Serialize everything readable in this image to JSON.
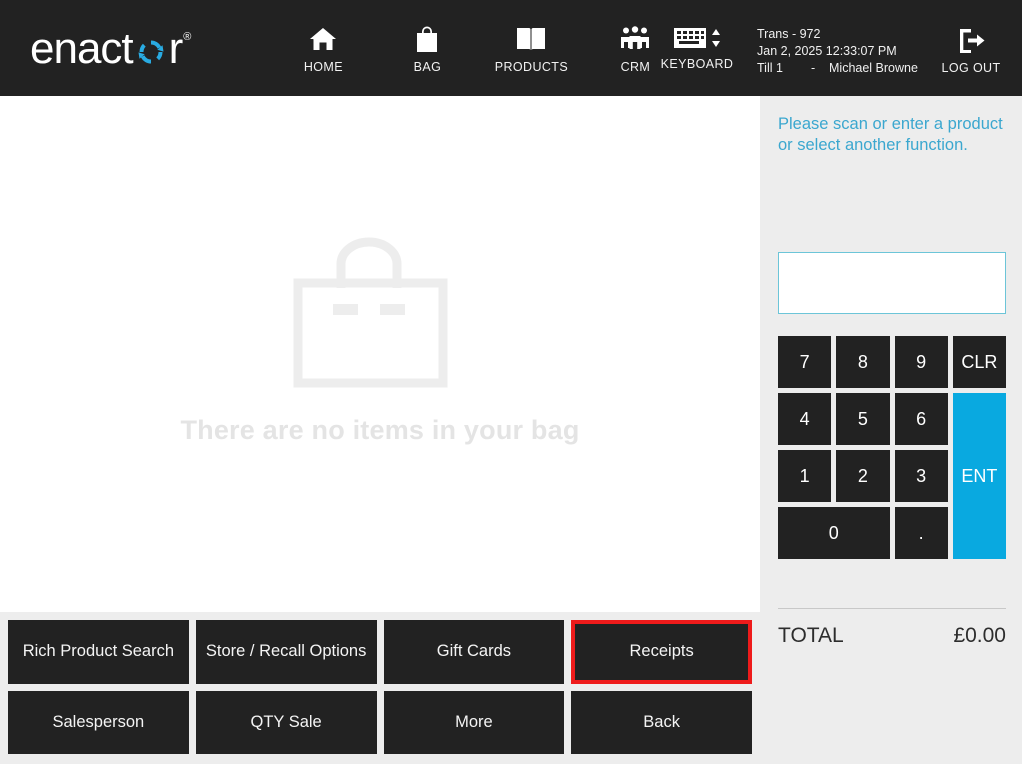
{
  "brand": {
    "name": "enactor",
    "name_part1": "enact",
    "name_part2": "r",
    "trademark": "®",
    "logo_icon": "circular-arrows-icon",
    "accent_color": "#29abe2"
  },
  "header": {
    "nav": [
      {
        "label": "HOME",
        "icon": "home-icon"
      },
      {
        "label": "BAG",
        "icon": "shopping-bag-icon"
      },
      {
        "label": "PRODUCTS",
        "icon": "open-book-icon"
      },
      {
        "label": "CRM",
        "icon": "people-group-icon"
      }
    ],
    "keyboard": {
      "label": "KEYBOARD",
      "icon": "keyboard-icon"
    },
    "transaction": {
      "trans": "Trans - 972",
      "datetime": "Jan 2, 2025 12:33:07 PM",
      "till": "Till 1",
      "separator": "-",
      "operator": "Michael Browne"
    },
    "logout": {
      "label": "LOG OUT",
      "icon": "logout-icon"
    }
  },
  "main": {
    "bag_icon": "empty-shopping-bag-illustration",
    "empty_message": "There are no items in your bag"
  },
  "function_buttons": [
    {
      "label": "Rich Product Search",
      "selected": false
    },
    {
      "label": "Store / Recall Options",
      "selected": false
    },
    {
      "label": "Gift Cards",
      "selected": false
    },
    {
      "label": "Receipts",
      "selected": true
    },
    {
      "label": "Salesperson",
      "selected": false
    },
    {
      "label": "QTY Sale",
      "selected": false
    },
    {
      "label": "More",
      "selected": false
    },
    {
      "label": "Back",
      "selected": false
    }
  ],
  "selection_highlight_color": "#ee1b1b",
  "right_panel": {
    "prompt_line1": "Please scan or enter a product",
    "prompt_line2": "or select another function.",
    "prompt_color": "#3ba7cf",
    "entry_value": "",
    "entry_placeholder": "",
    "numpad": [
      {
        "label": "7",
        "type": "digit"
      },
      {
        "label": "8",
        "type": "digit"
      },
      {
        "label": "9",
        "type": "digit"
      },
      {
        "label": "CLR",
        "type": "clear"
      },
      {
        "label": "4",
        "type": "digit"
      },
      {
        "label": "5",
        "type": "digit"
      },
      {
        "label": "6",
        "type": "digit"
      },
      {
        "label": "1",
        "type": "digit"
      },
      {
        "label": "2",
        "type": "digit"
      },
      {
        "label": "3",
        "type": "digit"
      },
      {
        "label": "0",
        "type": "digit-wide"
      },
      {
        "label": ".",
        "type": "decimal"
      },
      {
        "label": "ENT",
        "type": "enter"
      }
    ],
    "enter_key_color": "#09a9e0",
    "total_label": "TOTAL",
    "total_value": "£0.00"
  }
}
